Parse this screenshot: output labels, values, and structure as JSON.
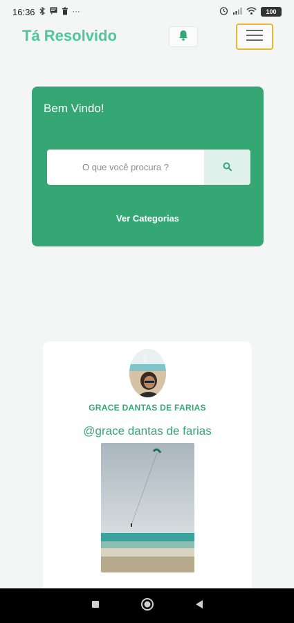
{
  "status_bar": {
    "time": "16:36",
    "left_icons": [
      "bluetooth-icon",
      "message-icon",
      "trash-icon",
      "more-dots-icon"
    ],
    "right_icons": [
      "alarm-icon",
      "signal-icon",
      "wifi-icon"
    ],
    "battery": "100"
  },
  "header": {
    "brand": "Tá Resolvido",
    "brand_color": "#4fc79a"
  },
  "hero": {
    "welcome": "Bem Vindo!",
    "search_placeholder": "O que você procura ?",
    "categories_link": "Ver Categorias",
    "background_color": "#34a774"
  },
  "profile": {
    "name": "GRACE DANTAS DE FARIAS",
    "handle": "@grace dantas de farias"
  }
}
